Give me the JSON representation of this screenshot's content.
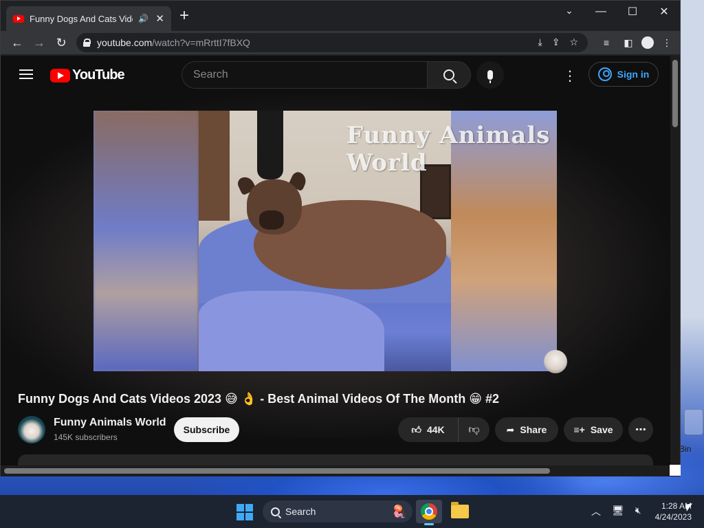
{
  "browser": {
    "tab_title": "Funny Dogs And Cats Videos",
    "url_domain": "youtube.com",
    "url_path": "/watch?v=mRrttI7fBXQ"
  },
  "youtube": {
    "logo_text": "YouTube",
    "search_placeholder": "Search",
    "signin_label": "Sign in",
    "video_watermark": "Funny Animals World",
    "video_title": "Funny Dogs And Cats Videos 2023 😅 👌 - Best Animal Videos Of The Month 😁 #2",
    "channel_name": "Funny Animals World",
    "subscribers": "145K subscribers",
    "subscribe_label": "Subscribe",
    "likes": "44K",
    "share_label": "Share",
    "save_label": "Save"
  },
  "desktop": {
    "recycle_bin_label": "Bin"
  },
  "taskbar": {
    "search_label": "Search",
    "time": "1:28 AM",
    "date": "4/24/2023"
  },
  "colors": {
    "brand_red": "#ff0000",
    "link_blue": "#3ea6ff",
    "page_bg": "#0f0f0f"
  }
}
